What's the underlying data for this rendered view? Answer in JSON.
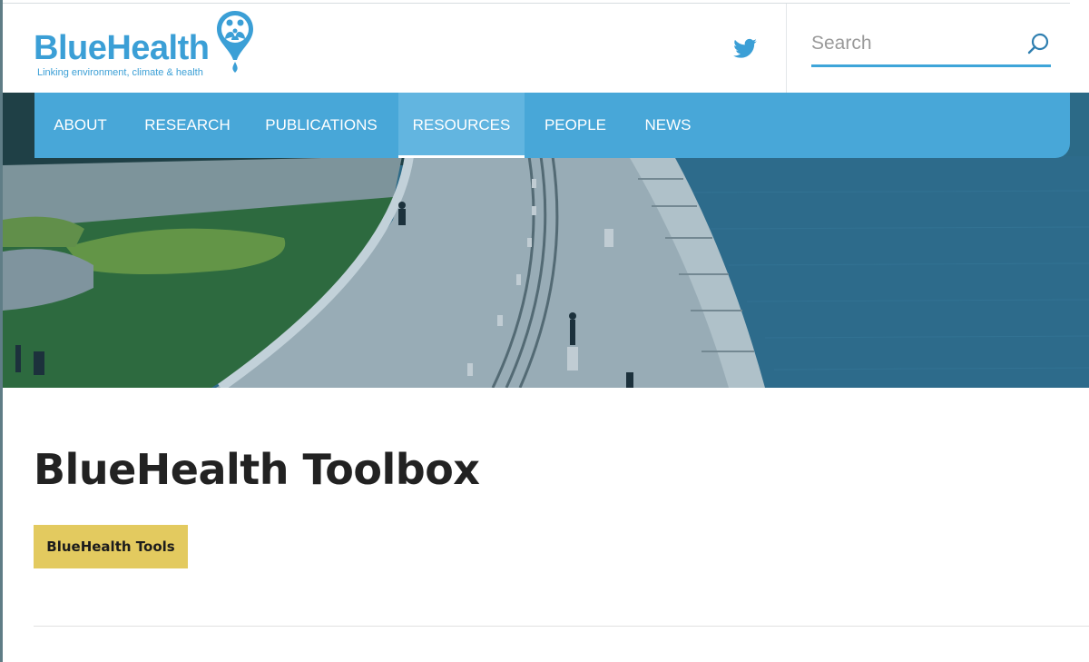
{
  "brand": {
    "name": "BlueHealth",
    "tagline": "Linking environment, climate & health"
  },
  "search": {
    "placeholder": "Search"
  },
  "nav": {
    "items": [
      {
        "label": "ABOUT"
      },
      {
        "label": "RESEARCH"
      },
      {
        "label": "PUBLICATIONS"
      },
      {
        "label": "RESOURCES",
        "active": true
      },
      {
        "label": "PEOPLE"
      },
      {
        "label": "NEWS"
      }
    ]
  },
  "main": {
    "title": "BlueHealth Toolbox",
    "tools_button": "BlueHealth Tools"
  },
  "icons": {
    "social": "twitter-icon",
    "search": "search-icon",
    "logo": "location-pin-family-icon"
  },
  "colors": {
    "brand_blue": "#3b9fd6",
    "nav_blue": "#48a7d8",
    "button_yellow": "#e3ca5f",
    "title_dark": "#222222"
  }
}
